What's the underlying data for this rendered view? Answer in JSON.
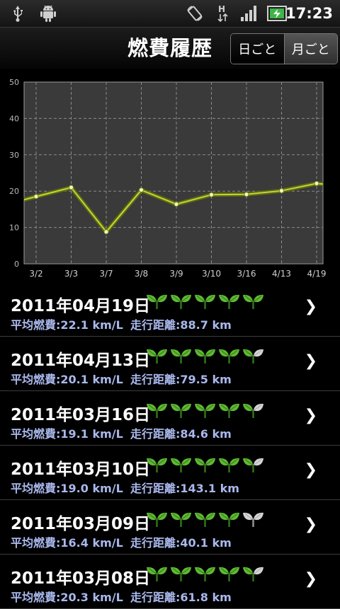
{
  "status": {
    "time": "17:23"
  },
  "header": {
    "title": "燃費履歴",
    "tab_day": "日ごと",
    "tab_month": "月ごと",
    "selected": "month"
  },
  "chart_data": {
    "type": "line",
    "categories": [
      "3/2",
      "3/3",
      "3/7",
      "3/8",
      "3/9",
      "3/10",
      "3/16",
      "4/13",
      "4/19"
    ],
    "values": [
      18.5,
      21.0,
      8.8,
      20.3,
      16.4,
      19.0,
      19.1,
      20.1,
      22.1
    ],
    "ylim": [
      0,
      50
    ],
    "yticks": [
      "0",
      "10",
      "20",
      "30",
      "40",
      "50"
    ],
    "grid": true,
    "colors": {
      "line": "#c6d33a",
      "plot_bg": "#3a3a3a",
      "grid": "#8a8a8a"
    }
  },
  "list": [
    {
      "date": "2011年04月19日",
      "avg": "平均燃費:22.1 km/L",
      "dist": "走行距離:88.7 km",
      "rating": 5
    },
    {
      "date": "2011年04月13日",
      "avg": "平均燃費:20.1 km/L",
      "dist": "走行距離:79.5 km",
      "rating": 4.5
    },
    {
      "date": "2011年03月16日",
      "avg": "平均燃費:19.1 km/L",
      "dist": "走行距離:84.6 km",
      "rating": 4.5
    },
    {
      "date": "2011年03月10日",
      "avg": "平均燃費:19.0 km/L",
      "dist": "走行距離:143.1 km",
      "rating": 4.5
    },
    {
      "date": "2011年03月09日",
      "avg": "平均燃費:16.4 km/L",
      "dist": "走行距離:40.1 km",
      "rating": 4
    },
    {
      "date": "2011年03月08日",
      "avg": "平均燃費:20.3 km/L",
      "dist": "走行距離:61.8 km",
      "rating": 4.5
    }
  ],
  "chevron": "❯",
  "icons": {
    "usb": "usb-icon",
    "android": "android-icon",
    "rotate": "rotate-icon",
    "data": "h-data-icon",
    "signal": "signal-icon",
    "battery": "battery-icon",
    "leaf": "leaf-icon"
  }
}
